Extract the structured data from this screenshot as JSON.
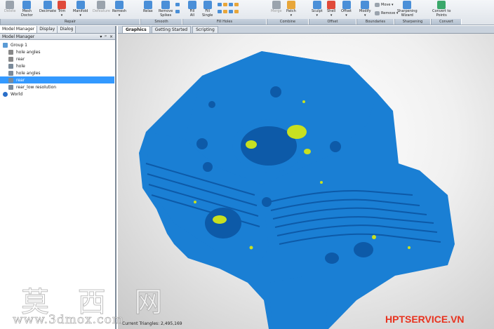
{
  "ribbon": {
    "buttons": [
      {
        "label": "Delete",
        "icon": "delete-icon",
        "color": "#9aa3ad",
        "disabled": true
      },
      {
        "label": "Mesh\nDoctor",
        "icon": "mesh-doctor-icon",
        "color": "#4a8fd8",
        "disabled": false
      },
      {
        "label": "Decimate",
        "icon": "decimate-icon",
        "color": "#4a8fd8",
        "disabled": false
      },
      {
        "label": "Trim\n▾",
        "icon": "trim-icon",
        "color": "#e04a3a",
        "disabled": false
      },
      {
        "label": "Manifold\n▾",
        "icon": "manifold-icon",
        "color": "#4a8fd8",
        "disabled": false
      },
      {
        "label": "Defeature",
        "icon": "defeature-icon",
        "color": "#9aa3ad",
        "disabled": true
      },
      {
        "label": "Remesh\n▾",
        "icon": "remesh-icon",
        "color": "#4a8fd8",
        "disabled": false
      },
      {
        "label": "Relax",
        "icon": "relax-icon",
        "color": "#4a8fd8",
        "disabled": false
      },
      {
        "label": "Remove\nSpikes",
        "icon": "remove-spikes-icon",
        "color": "#4a8fd8",
        "disabled": false
      },
      {
        "label": "Fill\nAll",
        "icon": "fill-all-icon",
        "color": "#4a8fd8",
        "disabled": false
      },
      {
        "label": "Fill\nSingle",
        "icon": "fill-single-icon",
        "color": "#4a8fd8",
        "disabled": false
      },
      {
        "label": "Merge",
        "icon": "merge-icon",
        "color": "#9aa3ad",
        "disabled": true
      },
      {
        "label": "Patch\n▾",
        "icon": "patch-icon",
        "color": "#e8a63a",
        "disabled": false
      },
      {
        "label": "Sculpt\n▾",
        "icon": "sculpt-icon",
        "color": "#4a8fd8",
        "disabled": false
      },
      {
        "label": "Shell\n▾",
        "icon": "shell-icon",
        "color": "#e04a3a",
        "disabled": false
      },
      {
        "label": "Offset\n▾",
        "icon": "offset-icon",
        "color": "#4a8fd8",
        "disabled": false
      },
      {
        "label": "Modify\n▾",
        "icon": "modify-icon",
        "color": "#4a8fd8",
        "disabled": false
      },
      {
        "label": "Move ▾",
        "icon": "move-icon",
        "color": "#9aa3ad",
        "disabled": false
      },
      {
        "label": "Remove ▾",
        "icon": "remove-icon",
        "color": "#9aa3ad",
        "disabled": false
      },
      {
        "label": "Sharpening\nWizard",
        "icon": "sharpening-wizard-icon",
        "color": "#4a8fd8",
        "disabled": false
      },
      {
        "label": "Convert to\nPoints",
        "icon": "convert-to-points-icon",
        "color": "#3aa86a",
        "disabled": false
      }
    ],
    "groups": [
      "Repair",
      "Smooth",
      "Fill Holes",
      "Combine",
      "Offset",
      "Boundaries",
      "Sharpening",
      "Convert"
    ]
  },
  "left_panel": {
    "tabs": [
      "Model Manager",
      "Display",
      "Dialog"
    ],
    "header_title": "Model Manager",
    "header_controls": [
      "▾",
      "ᵖ",
      "×"
    ],
    "tree": [
      {
        "label": "Group 1",
        "icon": "group-folder-icon",
        "selected": false
      },
      {
        "label": "hole angles",
        "icon": "point-cloud-icon",
        "selected": false
      },
      {
        "label": "rear",
        "icon": "point-cloud-icon",
        "selected": false
      },
      {
        "label": "hole",
        "icon": "mesh-icon",
        "selected": false
      },
      {
        "label": "hole angles",
        "icon": "mesh-icon",
        "selected": false
      },
      {
        "label": "rear",
        "icon": "mesh-icon",
        "selected": true
      },
      {
        "label": "rear_low resolution",
        "icon": "mesh-icon",
        "selected": false
      },
      {
        "label": "World",
        "icon": "world-globe-icon",
        "selected": false
      }
    ]
  },
  "main": {
    "tabs": [
      "Graphics",
      "Getting Started",
      "Scripting"
    ],
    "status_text": "Current Triangles: 2,495,169"
  },
  "model_colors": {
    "mesh": "#1a7fd4",
    "mesh_dark": "#0d5aa8",
    "holes": "#c8e020"
  },
  "watermarks": {
    "cn": "莫 西 网",
    "url": "www.3dmox.com",
    "brand": "HPTSERVICE.VN",
    "brand_color": "#e8321e"
  }
}
